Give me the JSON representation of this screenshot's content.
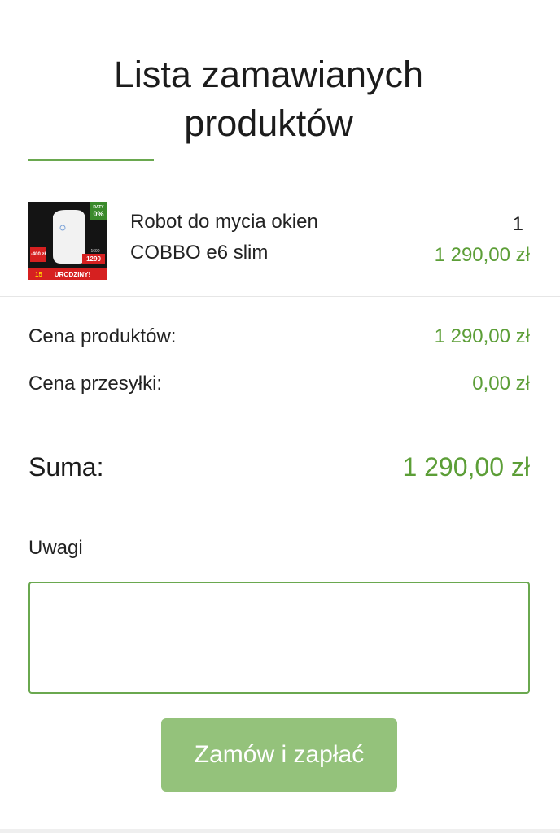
{
  "page": {
    "title_line1": "Lista zamawianych",
    "title_line2": "produktów"
  },
  "product": {
    "name_line1": "Robot do mycia okien",
    "name_line2": "COBBO e6 slim",
    "quantity": "1",
    "price": "1 290,00 zł",
    "thumb": {
      "badge_top": "RATY",
      "badge_pct": "0%",
      "promo_amount": "-400 zł",
      "old_price": "1690",
      "new_price": "1290",
      "banner_num": "15",
      "banner_text": "URODZINY!"
    }
  },
  "summary": {
    "products_label": "Cena produktów:",
    "products_value": "1 290,00 zł",
    "shipping_label": "Cena przesyłki:",
    "shipping_value": "0,00 zł",
    "total_label": "Suma:",
    "total_value": "1 290,00 zł"
  },
  "notes": {
    "label": "Uwagi",
    "value": "",
    "placeholder": ""
  },
  "actions": {
    "submit_label": "Zamów i zapłać"
  },
  "colors": {
    "accent_green": "#5c9e37",
    "button_green": "#94c27b",
    "border_green": "#6aa84f"
  }
}
